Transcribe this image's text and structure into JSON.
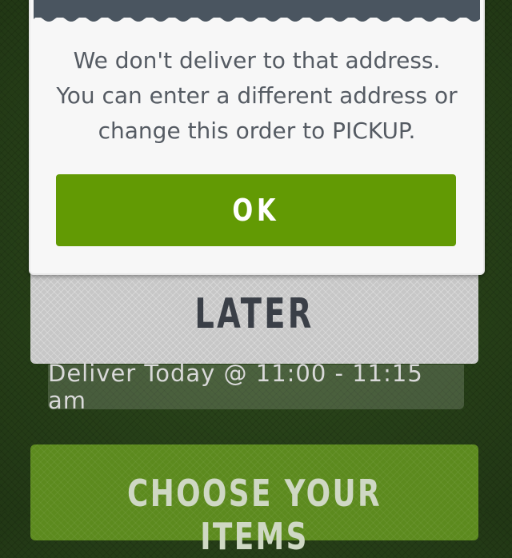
{
  "modal": {
    "message_lines": [
      "We don't deliver to that address.",
      "You can enter a different address or",
      "change this order to PICKUP."
    ],
    "ok_label": "OK"
  },
  "timing": {
    "later_label": "LATER",
    "schedule_text": "Deliver Today @ 11:00 - 11:15 am"
  },
  "next": {
    "choose_label": "CHOOSE YOUR ITEMS"
  },
  "colors": {
    "ok_button": "#629a04",
    "modal_header": "#4a5560",
    "background": "#2d4a1c"
  }
}
